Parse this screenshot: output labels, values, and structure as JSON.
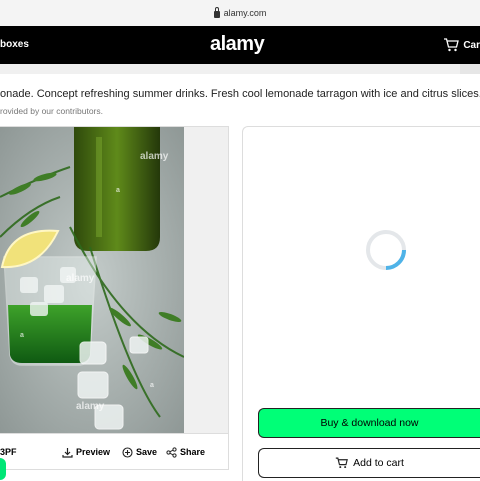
{
  "browser": {
    "url": "alamy.com"
  },
  "header": {
    "left_label": "boxes",
    "logo": "alamy",
    "cart_label": "Car"
  },
  "image": {
    "title": "onade. Concept refreshing summer drinks. Fresh cool lemonade tarragon with ice and citrus slices.",
    "subtitle": "rovided by our contributors.",
    "id_text": "3PF",
    "watermarks": [
      "alamy",
      "alamy",
      "alamy",
      "a",
      "a",
      "a"
    ]
  },
  "image_actions": {
    "preview": "Preview",
    "save": "Save",
    "share": "Share"
  },
  "purchase": {
    "buy_label": "Buy & download now",
    "cart_label": "Add to cart"
  },
  "colors": {
    "brand_black": "#000000",
    "buy_green": "#00ff77",
    "spinner_blue": "#4fb3e8"
  }
}
